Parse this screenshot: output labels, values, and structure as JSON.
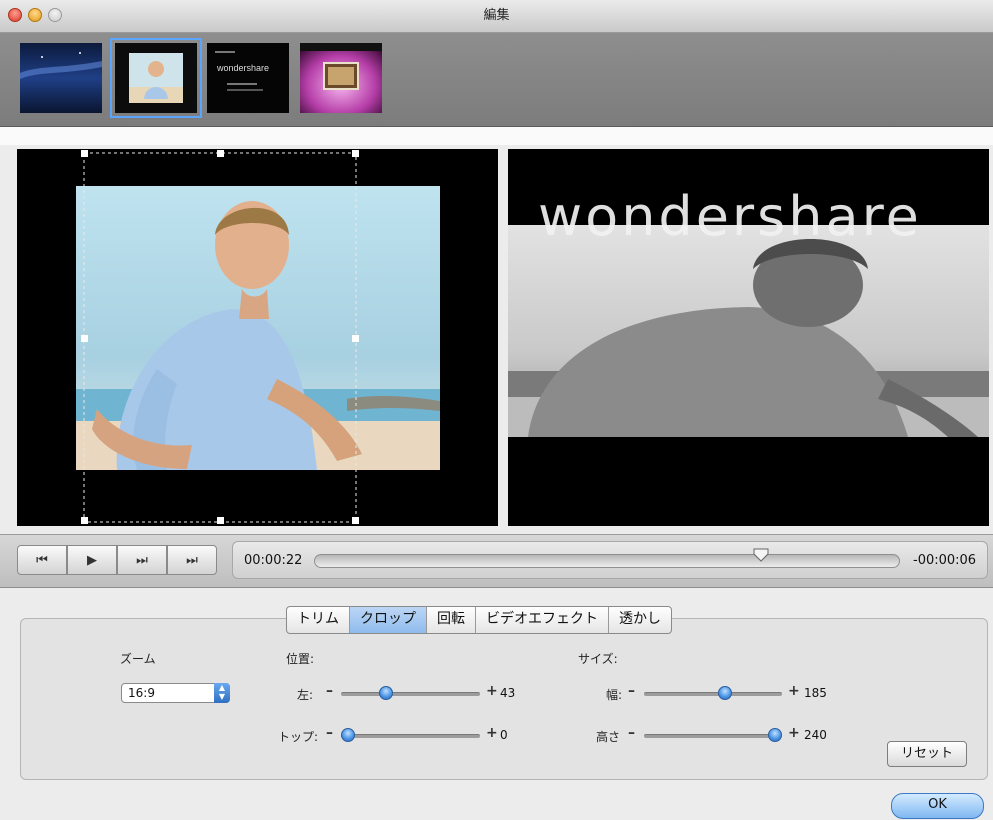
{
  "window": {
    "title": "編集"
  },
  "thumbnails": [
    {
      "name": "night-scene"
    },
    {
      "name": "boy-photo",
      "selected": true
    },
    {
      "name": "wondershare-title",
      "brand": "wondershare"
    },
    {
      "name": "pink-desktop"
    }
  ],
  "preview": {
    "watermark_text": "wondershare"
  },
  "transport": {
    "current_time": "00:00:22",
    "remaining_time": "-00:00:06",
    "playhead_fraction": 0.77
  },
  "tabs": [
    "トリム",
    "クロップ",
    "回転",
    "ビデオエフェクト",
    "透かし"
  ],
  "active_tab": "クロップ",
  "zoom": {
    "label": "ズーム",
    "value": "16:9"
  },
  "position": {
    "label": "位置:",
    "left": {
      "label": "左:",
      "value": "43",
      "fraction": 0.3
    },
    "top": {
      "label": "トップ:",
      "value": "0",
      "fraction": 0.0
    }
  },
  "size": {
    "label": "サイズ:",
    "width": {
      "label": "幅:",
      "value": "185",
      "fraction": 0.6
    },
    "height": {
      "label": "高さ",
      "value": "240",
      "fraction": 1.0
    }
  },
  "symbols": {
    "minus": "–",
    "plus": "+"
  },
  "buttons": {
    "reset": "リセット",
    "ok": "OK"
  }
}
